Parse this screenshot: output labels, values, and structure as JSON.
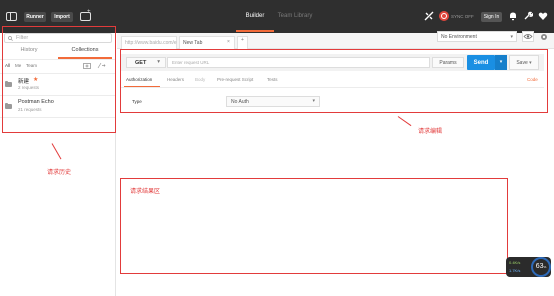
{
  "topbar": {
    "runner_label": "Runner",
    "import_label": "Import",
    "builder_label": "Builder",
    "team_library_label": "Team Library",
    "sync_text": "SYNC OFF",
    "signin_label": "Sign In"
  },
  "sidebar": {
    "search_placeholder": "Filter",
    "tabs": [
      "History",
      "Collections"
    ],
    "filters": [
      "All",
      "Me",
      "Team"
    ],
    "collections": [
      {
        "name": "新建",
        "sub": "2 requests",
        "starred": true,
        "star": "★"
      },
      {
        "name": "Postman Echo",
        "sub": "21 requests",
        "starred": false
      }
    ],
    "annotation": "请求历史"
  },
  "main": {
    "tabs": [
      {
        "label": "http://www.baidu.com/e"
      },
      {
        "label": "New Tab"
      }
    ],
    "tab_close": "×",
    "add_tab": "+",
    "environment": "No Environment",
    "method": "GET",
    "url_placeholder": "Enter request URL",
    "params_label": "Params",
    "send_label": "Send",
    "save_label": "Save",
    "subtabs": [
      "Authorization",
      "Headers",
      "Body",
      "Pre-request Script",
      "Tests"
    ],
    "code_label": "Code",
    "type_label": "Type",
    "auth_value": "No Auth",
    "editor_annotation": "请求编辑",
    "response_annotation": "请求结果区"
  },
  "gauge": {
    "value": "63",
    "unit": "%",
    "up_speed": "0.4K/s",
    "down_speed": "1.7K/s"
  },
  "colors": {
    "accent": "#f26b3a",
    "send": "#1a8fe3",
    "annotation": "#e23b3b",
    "topbar": "#2f2f2f"
  }
}
